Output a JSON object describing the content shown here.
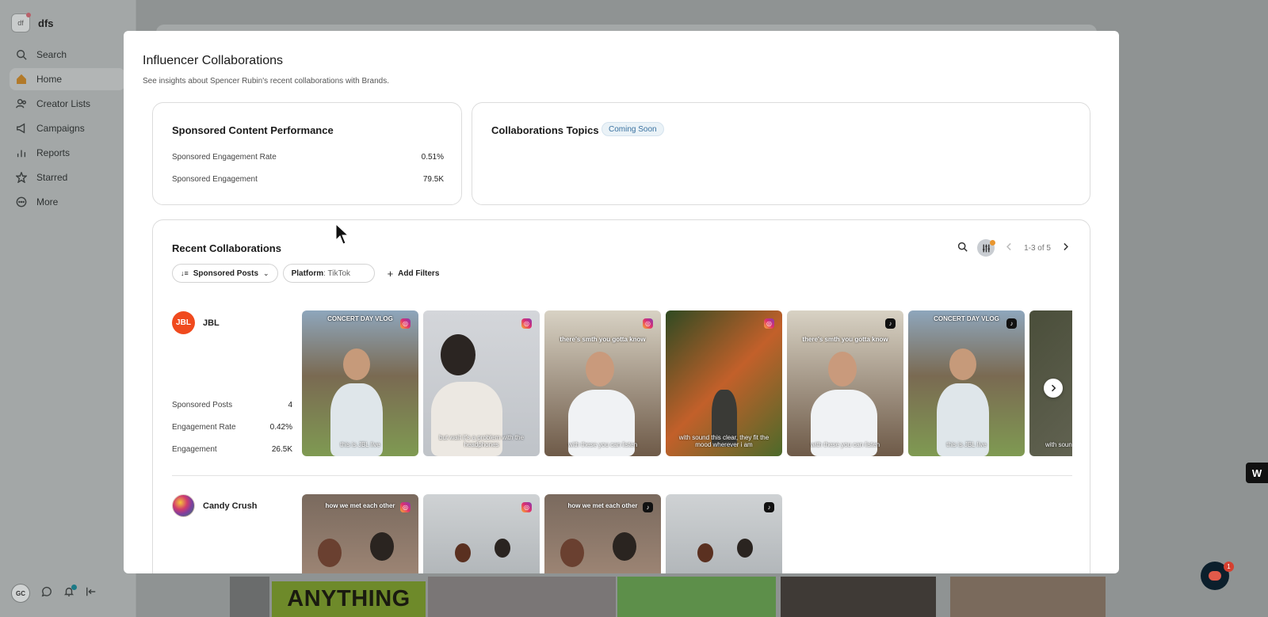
{
  "workspace": {
    "name": "dfs",
    "logo_text": "df"
  },
  "sidebar": {
    "items": [
      {
        "label": "Search",
        "icon": "search-icon"
      },
      {
        "label": "Home",
        "icon": "home-icon",
        "active": true
      },
      {
        "label": "Creator Lists",
        "icon": "users-icon"
      },
      {
        "label": "Campaigns",
        "icon": "megaphone-icon"
      },
      {
        "label": "Reports",
        "icon": "bar-chart-icon"
      },
      {
        "label": "Starred",
        "icon": "star-icon"
      },
      {
        "label": "More",
        "icon": "more-icon"
      }
    ],
    "user_initials": "GC"
  },
  "background": {
    "banner_text": "ANYTHING"
  },
  "modal": {
    "title": "Influencer Collaborations",
    "subtitle": "See insights about Spencer Rubin's recent collaborations with Brands.",
    "performance": {
      "title": "Sponsored Content Performance",
      "rows": [
        {
          "label": "Sponsored Engagement Rate",
          "value": "0.51%"
        },
        {
          "label": "Sponsored Engagement",
          "value": "79.5K"
        }
      ]
    },
    "topics": {
      "title": "Collaborations Topics",
      "badge": "Coming Soon"
    },
    "recent": {
      "title": "Recent Collaborations",
      "sort_chip": "Sponsored Posts",
      "platform_label": "Platform",
      "platform_value": ": TikTok",
      "add_filters": "Add Filters",
      "pagination": "1-3 of 5",
      "brands": [
        {
          "name": "JBL",
          "logo_text": "JBL",
          "logo_color": "#f04a1e",
          "stats": [
            {
              "label": "Sponsored Posts",
              "value": "4"
            },
            {
              "label": "Engagement Rate",
              "value": "0.42%"
            },
            {
              "label": "Engagement",
              "value": "26.5K"
            }
          ],
          "posts": [
            {
              "top": "CONCERT DAY VLOG",
              "bottom": "this is JBL live",
              "platform": "instagram"
            },
            {
              "top": "",
              "bottom": "but wait it's a problem with the headphones",
              "platform": "instagram"
            },
            {
              "top": "there's smth you gotta know",
              "bottom": "with these you can listen",
              "platform": "instagram"
            },
            {
              "top": "",
              "bottom": "with sound this clear, they fit the mood wherever i am",
              "platform": "instagram"
            },
            {
              "top": "there's smth you gotta know",
              "bottom": "with these you can listen",
              "platform": "tiktok"
            },
            {
              "top": "CONCERT DAY VLOG",
              "bottom": "this is JBL live",
              "platform": "tiktok"
            },
            {
              "top": "",
              "bottom": "with sound the mo",
              "platform": "instagram"
            }
          ]
        },
        {
          "name": "Candy Crush",
          "logo_text": "",
          "logo_color": "#7b3fa0",
          "posts": [
            {
              "top": "how we met each other",
              "platform": "instagram"
            },
            {
              "top": "",
              "platform": "instagram"
            },
            {
              "top": "how we met each other",
              "platform": "tiktok"
            },
            {
              "top": "",
              "platform": "tiktok"
            }
          ]
        }
      ]
    }
  },
  "floating": {
    "chat_badge": "1",
    "w_badge": "W"
  }
}
